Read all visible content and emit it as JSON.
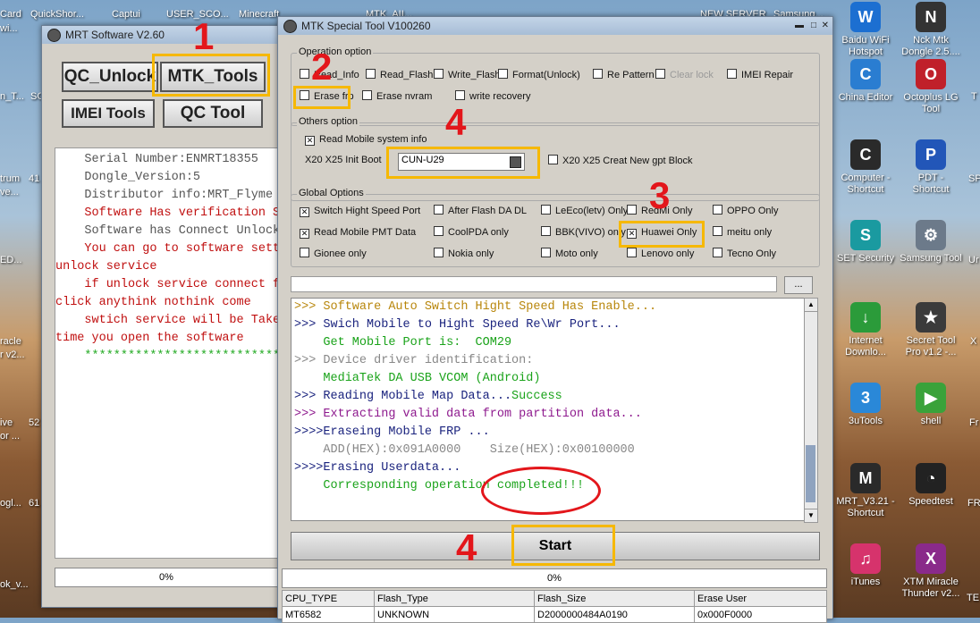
{
  "desktop": {
    "top_row": [
      "Card",
      "QuickShor...",
      "Captui",
      "USER_SCO...",
      "Minecraft",
      "MTK_AII...",
      "NEW SERVER",
      "Samsung..."
    ],
    "left_edge": [
      "wi...",
      "n_T...",
      "SC",
      "trum",
      "41",
      "ve...",
      "ED...",
      "racle",
      "r v2...",
      "ive",
      "52",
      "or ...",
      "ogl...",
      "61",
      "ok_v..."
    ],
    "right_icons": [
      {
        "label": "Baidu WiFi Hotspot",
        "color": "#1c6fd1",
        "glyph": "W"
      },
      {
        "label": "Nck Mtk Dongle 2.5....",
        "color": "#333333",
        "glyph": "N"
      },
      {
        "label": "China Editor",
        "color": "#2a7dd1",
        "glyph": "C"
      },
      {
        "label": "Octoplus LG Tool",
        "color": "#c0202a",
        "glyph": "O"
      },
      {
        "label": "Computer - Shortcut",
        "color": "#2a2a2a",
        "glyph": "C"
      },
      {
        "label": "PDT - Shortcut",
        "color": "#2256b8",
        "glyph": "P"
      },
      {
        "label": "SET Security",
        "color": "#1a9aa0",
        "glyph": "S"
      },
      {
        "label": "Samsung Tool",
        "color": "#6c7a8a",
        "glyph": "⚙"
      },
      {
        "label": "Internet Downlo...",
        "color": "#2b9b3a",
        "glyph": "↓"
      },
      {
        "label": "Secret Tool Pro v1.2 -...",
        "color": "#3b3b3b",
        "glyph": "★"
      },
      {
        "label": "3uTools",
        "color": "#2a88d8",
        "glyph": "3"
      },
      {
        "label": "shell",
        "color": "#3aa23a",
        "glyph": "▶"
      },
      {
        "label": "MRT_V3.21 - Shortcut",
        "color": "#2a2a2a",
        "glyph": "M"
      },
      {
        "label": "Speedtest",
        "color": "#222222",
        "glyph": "◔"
      },
      {
        "label": "iTunes",
        "color": "#d6336c",
        "glyph": "♫"
      },
      {
        "label": "XTM Miracle Thunder v2...",
        "color": "#8a2a8a",
        "glyph": "X"
      }
    ],
    "right_edge": [
      "SP",
      "Ur",
      "X D",
      "Fr",
      "FR",
      "T",
      "TE"
    ]
  },
  "mrt": {
    "title": "MRT Software V2.60",
    "buttons": {
      "qc_unlock": "QC_Unlock",
      "mtk_tools": "MTK_Tools",
      "imei_tools": "IMEI Tools",
      "qc_tool": "QC Tool"
    },
    "info_lines": [
      {
        "text": "    Serial Number:ENMRT18355",
        "color": "#555555"
      },
      {
        "text": "    Dongle_Version:5",
        "color": "#555555"
      },
      {
        "text": "    Distributor info:MRT_Flyme",
        "color": "#555555"
      },
      {
        "text": "    Software Has verification S",
        "color": "#c01010"
      },
      {
        "text": "    Software has Connect Unlock",
        "color": "#555555"
      },
      {
        "text": "    You can go to software sett",
        "color": "#c01010"
      },
      {
        "text": "unlock service",
        "color": "#c01010"
      },
      {
        "text": "    if unlock service connect f",
        "color": "#c01010"
      },
      {
        "text": "click anythink nothink come",
        "color": "#c01010"
      },
      {
        "text": "    swtich service will be Take",
        "color": "#c01010"
      },
      {
        "text": "time you open the software",
        "color": "#c01010"
      },
      {
        "text": "    *****************************",
        "color": "#22aa22"
      }
    ],
    "progress": "0%"
  },
  "mtk": {
    "title": "MTK Special Tool V100260",
    "operation_label": "Operation option",
    "operation_row1": [
      {
        "label": "Read_Info",
        "checked": false
      },
      {
        "label": "Read_Flash",
        "checked": false
      },
      {
        "label": "Write_Flash",
        "checked": false
      },
      {
        "label": "Format(Unlock)",
        "checked": false
      },
      {
        "label": "Re Pattern lo",
        "checked": false
      },
      {
        "label": "Clear lock",
        "checked": false,
        "disabled": true
      },
      {
        "label": "IMEI Repair",
        "checked": false
      }
    ],
    "operation_row2": [
      {
        "label": "Erase frp",
        "checked": false
      },
      {
        "label": "Erase nvram",
        "checked": false
      },
      {
        "label": "write recovery",
        "checked": false
      }
    ],
    "others_label": "Others option",
    "read_mobile": {
      "label": "Read Mobile system info",
      "checked": true
    },
    "init_boot_label": "X20 X25 Init Boot",
    "init_boot_value": "CUN-U29",
    "gpt_block": {
      "label": "X20 X25 Creat New gpt Block",
      "checked": false
    },
    "global_label": "Global Options",
    "global_options": [
      {
        "label": "Switch Hight Speed Port",
        "checked": true
      },
      {
        "label": "After Flash DA DL",
        "checked": false
      },
      {
        "label": "LeEco(letv) Only",
        "checked": false
      },
      {
        "label": "RedMi Only",
        "checked": false
      },
      {
        "label": "OPPO Only",
        "checked": false
      },
      {
        "label": "Read Mobile PMT Data",
        "checked": true
      },
      {
        "label": "CoolPDA only",
        "checked": false
      },
      {
        "label": "BBK(VIVO) only",
        "checked": false
      },
      {
        "label": "Huawei Only",
        "checked": true
      },
      {
        "label": "meitu only",
        "checked": false
      },
      {
        "label": "Gionee only",
        "checked": false
      },
      {
        "label": "Nokia only",
        "checked": false
      },
      {
        "label": "Moto only",
        "checked": false
      },
      {
        "label": "Lenovo only",
        "checked": false
      },
      {
        "label": "Tecno Only",
        "checked": false
      }
    ],
    "browse_label": "...",
    "log": [
      {
        "text": ">>> Software Auto Switch Hight Speed Has Enable...",
        "color": "#b8860b"
      },
      {
        "text": ">>> Swich Mobile to Hight Speed Re\\Wr Port...",
        "color": "#1a237e"
      },
      {
        "text": "    Get Mobile Port is:  COM29",
        "color": "#1aa31a"
      },
      {
        "text": ">>> Device driver identification:",
        "color": "#888888"
      },
      {
        "text": "    MediaTek DA USB VCOM (Android)",
        "color": "#1aa31a"
      },
      {
        "text": ">>> Reading Mobile Map Data...",
        "color": "#1a237e",
        "suffix": "Success",
        "suffix_color": "#1aa31a"
      },
      {
        "text": ">>> Extracting valid data from partition data...",
        "color": "#8e1a8e"
      },
      {
        "text": ">>>>Eraseing Mobile FRP ...",
        "color": "#1a237e"
      },
      {
        "text": "    ADD(HEX):0x091A0000    Size(HEX):0x00100000",
        "color": "#888888"
      },
      {
        "text": ">>>>Erasing Userdata...",
        "color": "#1a237e"
      },
      {
        "text": "    Corresponding operation completed!!!",
        "color": "#1aa31a"
      }
    ],
    "start_label": "Start",
    "progress": "0%",
    "table_headers": [
      "CPU_TYPE",
      "Flash_Type",
      "Flash_Size",
      "Erase User"
    ],
    "table_row": [
      "MT6582",
      "UNKNOWN",
      "D2000000484A0190",
      "0x000F0000"
    ]
  },
  "annotations": {
    "n1": "1",
    "n2": "2",
    "n3": "3",
    "n4a": "4",
    "n4b": "4",
    "highlight": "#f6b800",
    "red": "#e3161b"
  }
}
